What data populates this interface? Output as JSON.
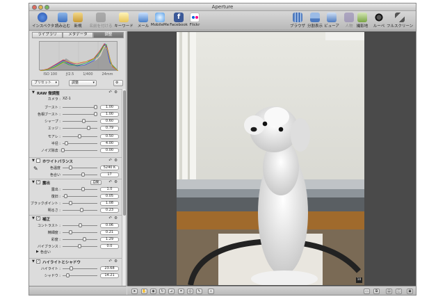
{
  "window": {
    "title": "Aperture"
  },
  "toolbar": {
    "inspector": "インスペクタ",
    "import": "読み込む",
    "new": "新規",
    "stack_tag": "名前を付ける",
    "keyword": "キーワード",
    "mail": "メール",
    "mobileme": "MobileMe",
    "facebook": "Facebook",
    "flickr": "Flickr",
    "browser": "ブラウザ",
    "split_view": "分割表示",
    "viewer": "ビューア",
    "people": "人物",
    "places": "撮影地",
    "loupe": "ルーペ",
    "fullscreen": "フルスクリーン"
  },
  "inspector": {
    "tabs": [
      "ライブラリ",
      "メタデータ",
      "調整"
    ],
    "active_tab": "調整",
    "exif": {
      "iso": "ISO 100",
      "aperture": "ƒ/2.5",
      "shutter": "1/400",
      "focal": "24mm"
    },
    "presets_label": "プリセット",
    "adjust_label": "調整"
  },
  "sections": {
    "raw": {
      "title": "RAW 微調整",
      "camera_label": "カメラ :",
      "camera_value": "XZ-1",
      "rows": [
        {
          "label": "ブースト :",
          "value": "1.00",
          "pos": 0.98
        },
        {
          "label": "色相ブースト :",
          "value": "1.00",
          "pos": 0.98
        },
        {
          "label": "シャープ :",
          "value": "0.60",
          "pos": 0.62
        },
        {
          "label": "エッジ :",
          "value": "0.79",
          "pos": 0.78
        },
        {
          "label": "モアレ :",
          "value": "0.50",
          "pos": 0.5
        },
        {
          "label": "半径 :",
          "value": "4.00",
          "pos": 0.1
        },
        {
          "label": "ノイズ除去 :",
          "value": "0.00",
          "pos": 0.0
        }
      ]
    },
    "wb": {
      "title": "ホワイトバランス",
      "rows": [
        {
          "label": "色温度",
          "value": "5240 K",
          "pos": 0.22
        },
        {
          "label": "色合い",
          "value": "17",
          "pos": 0.6
        }
      ]
    },
    "exposure": {
      "title": "露出",
      "auto": "自動",
      "rows": [
        {
          "label": "露出 :",
          "value": "1.0",
          "pos": 0.6
        },
        {
          "label": "復旧 :",
          "value": "0.05",
          "pos": 0.08
        },
        {
          "label": "ブラックポイント :",
          "value": "1.08",
          "pos": 0.22
        },
        {
          "label": "明るさ :",
          "value": "0.23",
          "pos": 0.56
        }
      ]
    },
    "enhance": {
      "title": "補正",
      "rows": [
        {
          "label": "コントラスト :",
          "value": "0.06",
          "pos": 0.52
        },
        {
          "label": "精細度 :",
          "value": "0.21",
          "pos": 0.22
        },
        {
          "label": "彩度 :",
          "value": "1.29",
          "pos": 0.65
        },
        {
          "label": "バイブランス :",
          "value": "0.0",
          "pos": 0.5
        }
      ],
      "tint": "色合い"
    },
    "highlights": {
      "title": "ハイライトとシャドウ",
      "rows": [
        {
          "label": "ハイライト :",
          "value": "23.68",
          "pos": 0.24
        },
        {
          "label": "シャドウ :",
          "value": "14.21",
          "pos": 0.14
        }
      ]
    }
  },
  "viewer": {
    "badge": "10"
  }
}
